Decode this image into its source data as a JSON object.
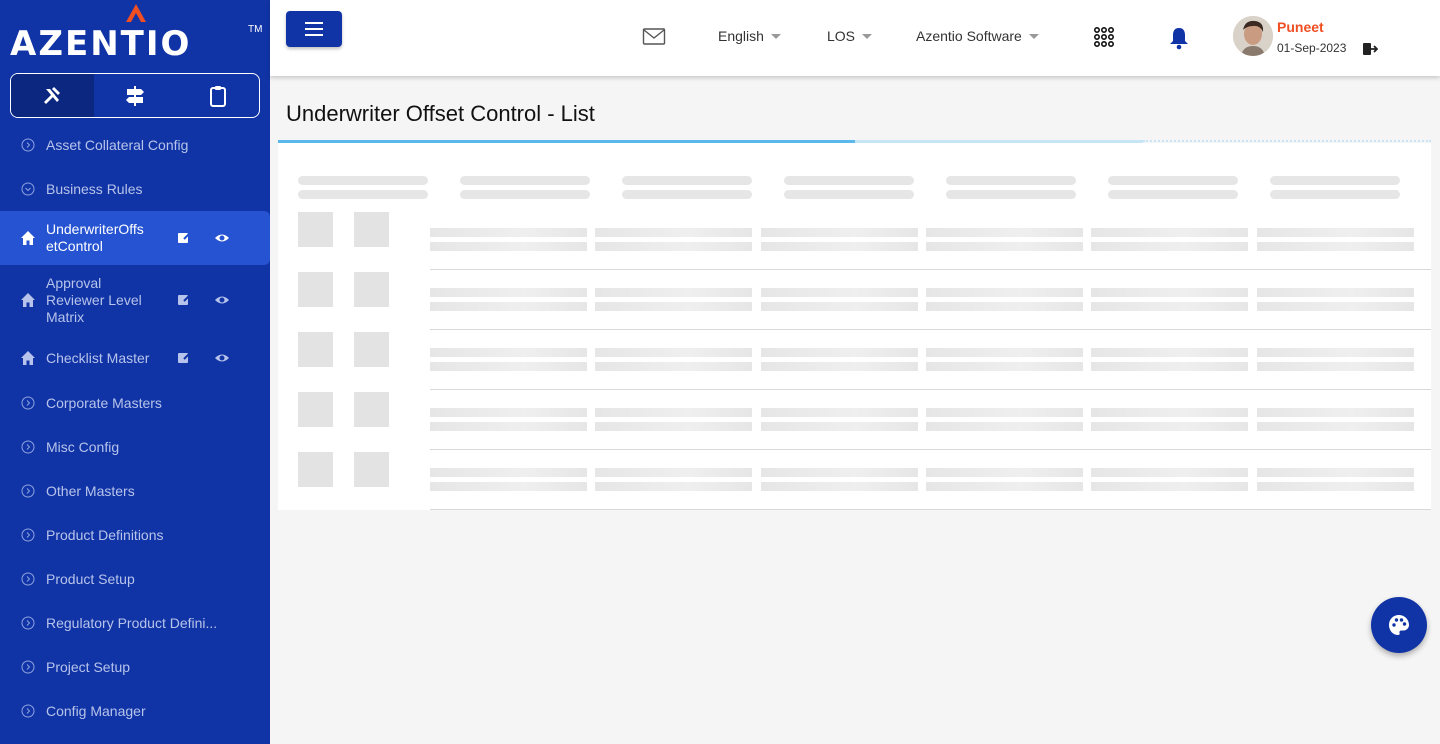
{
  "app": {
    "logo_text": "AZENTIO",
    "logo_tm": "TM"
  },
  "sidebar": {
    "modes": [
      {
        "icon": "tools-icon",
        "active": true
      },
      {
        "icon": "signpost-icon",
        "active": false
      },
      {
        "icon": "clipboard-icon",
        "active": false
      }
    ],
    "items": [
      {
        "label": "Asset Collateral Config"
      },
      {
        "label": "Business Rules"
      },
      {
        "label": "UnderwriterOffsetControl"
      },
      {
        "label": "Approval Reviewer Level Matrix"
      },
      {
        "label": "Checklist Master"
      },
      {
        "label": "Corporate Masters"
      },
      {
        "label": "Misc Config"
      },
      {
        "label": "Other Masters"
      },
      {
        "label": "Product Definitions"
      },
      {
        "label": "Product Setup"
      },
      {
        "label": "Regulatory Product Defini..."
      },
      {
        "label": "Project Setup"
      },
      {
        "label": "Config Manager"
      }
    ]
  },
  "header": {
    "language": "English",
    "module": "LOS",
    "organization": "Azentio Software",
    "user": {
      "name": "Puneet",
      "date": "01-Sep-2023"
    }
  },
  "page": {
    "title": "Underwriter Offset Control - List"
  },
  "colors": {
    "primary": "#1034a6",
    "active": "#2553d1",
    "user_name": "#f04e23",
    "accent_line": "#5bb8ea"
  }
}
